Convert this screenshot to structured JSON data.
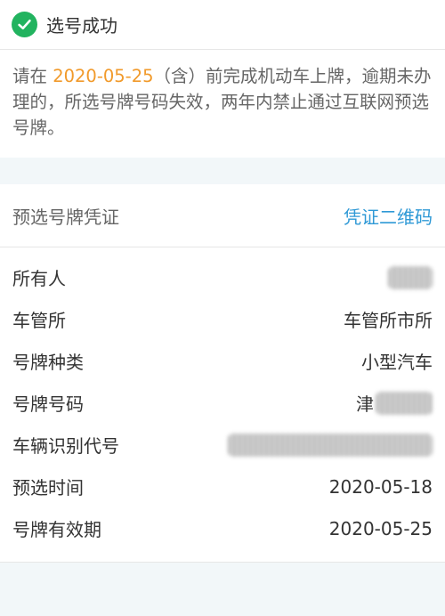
{
  "status": {
    "icon": "check-circle-icon",
    "text": "选号成功",
    "color": "#22b35f"
  },
  "notice": {
    "prefix": "请在 ",
    "date": "2020-05-25",
    "suffix": "（含）前完成机动车上牌，逾期未办理的，所选号牌号码失效，两年内禁止通过互联网预选号牌。"
  },
  "card": {
    "title": "预选号牌凭证",
    "qr_link": "凭证二维码",
    "rows": [
      {
        "label": "所有人",
        "value": ""
      },
      {
        "label": "车管所",
        "value": "车管所市所"
      },
      {
        "label": "号牌种类",
        "value": "小型汽车"
      },
      {
        "label": "号牌号码",
        "value": "津"
      },
      {
        "label": "车辆识别代号",
        "value": ""
      },
      {
        "label": "预选时间",
        "value": "2020-05-18"
      },
      {
        "label": "号牌有效期",
        "value": "2020-05-25"
      }
    ]
  },
  "colors": {
    "accent_link": "#2f99d6",
    "date_highlight": "#f19a2b",
    "background": "#f2f7f9"
  }
}
